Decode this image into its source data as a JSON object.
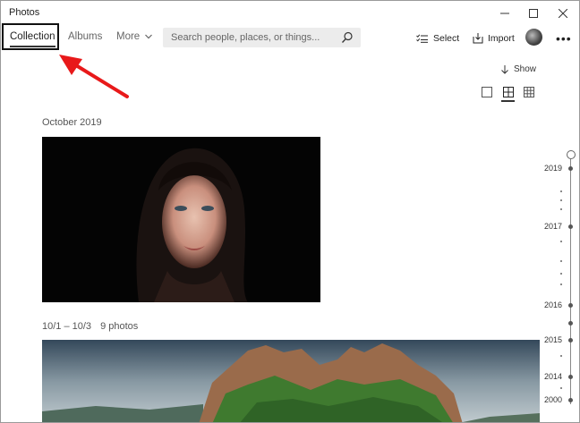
{
  "window": {
    "title": "Photos",
    "minimize_icon": "minimize-icon",
    "maximize_icon": "maximize-icon",
    "close_icon": "close-icon"
  },
  "nav": {
    "tabs": [
      {
        "label": "Collection",
        "active": true
      },
      {
        "label": "Albums",
        "active": false
      },
      {
        "label": "More",
        "active": false
      }
    ]
  },
  "search": {
    "placeholder": "Search people, places, or things..."
  },
  "toolbar": {
    "select_label": "Select",
    "import_label": "Import",
    "more_icon": "more-dots-icon"
  },
  "view": {
    "show_label": "Show",
    "modes": [
      "single-view-icon",
      "medium-grid-icon",
      "small-grid-icon"
    ],
    "selected_mode": "medium-grid-icon"
  },
  "groups": [
    {
      "label": "October 2019",
      "photos_count": ""
    },
    {
      "label": "10/1 – 10/3",
      "photos_count": "9 photos"
    }
  ],
  "timeline": {
    "years": [
      "2019",
      "2017",
      "2016",
      "2015",
      "2014",
      "2000"
    ]
  },
  "colors": {
    "accent": "#333333",
    "annotation_arrow": "#e8191a"
  }
}
